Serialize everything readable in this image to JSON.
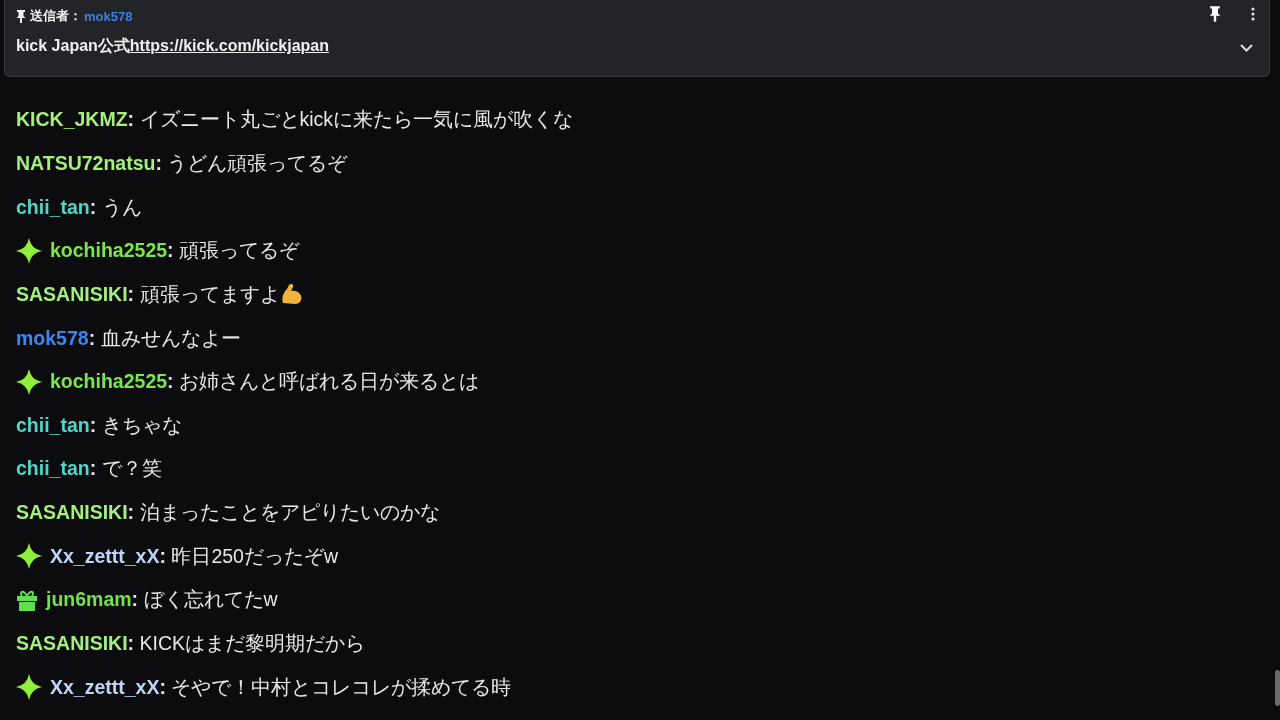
{
  "pinned": {
    "label": "送信者：",
    "sender": "mok578",
    "text": "kick Japan公式",
    "link": "https://kick.com/kickjapan"
  },
  "messages": [
    {
      "user": "KICK_JKMZ",
      "color": "#a3f07f",
      "kind": "plain",
      "text": "**:** イズニート丸ごとkickに来たら一気に風が吹くな"
    },
    {
      "user": "NATSU72natsu",
      "color": "#a3f07f",
      "kind": "plain",
      "text": "**:** うどん頑張ってるぞ"
    },
    {
      "user": "chii_tan",
      "color": "#4fd6c8",
      "kind": "plain",
      "text": "**:** うん"
    },
    {
      "user": "kochiha2525",
      "color": "#7ae84a",
      "kind": "sparkle",
      "text": "**:** 頑張ってるぞ"
    },
    {
      "user": "SASANISIKI",
      "color": "#a3f07f",
      "kind": "plain",
      "text": "**:** 頑張ってますよ",
      "emotes": [
        {
          "kind": "muscle"
        }
      ]
    },
    {
      "user": "mok578",
      "color": "#3d86f0",
      "kind": "plain",
      "text": "**:** 血みせんなよー"
    },
    {
      "user": "kochiha2525",
      "color": "#7ae84a",
      "kind": "sparkle",
      "text": "**:** お姉さんと呼ばれる日が来るとは"
    },
    {
      "user": "chii_tan",
      "color": "#4fd6c8",
      "kind": "plain",
      "text": "**:** きちゃな"
    },
    {
      "user": "chii_tan",
      "color": "#4fd6c8",
      "kind": "plain",
      "text": "**:** で？笑"
    },
    {
      "user": "SASANISIKI",
      "color": "#a3f07f",
      "kind": "plain",
      "text": "**:** 泊まったことをアピりたいのかな"
    },
    {
      "user": "Xx_zettt_xX",
      "color": "#bcd6f7",
      "kind": "sparkle",
      "text": "**:** 昨日250だったぞw"
    },
    {
      "user": "jun6mam",
      "color": "#74e04e",
      "kind": "gift",
      "text": "**:** ぼく忘れてたw"
    },
    {
      "user": "SASANISIKI",
      "color": "#a3f07f",
      "kind": "plain",
      "text": "**:** KICKはまだ黎明期だから"
    },
    {
      "user": "Xx_zettt_xX",
      "color": "#bcd6f7",
      "kind": "sparkle",
      "text": "**:** そやで！中村とコレコレが揉めてる時"
    }
  ]
}
